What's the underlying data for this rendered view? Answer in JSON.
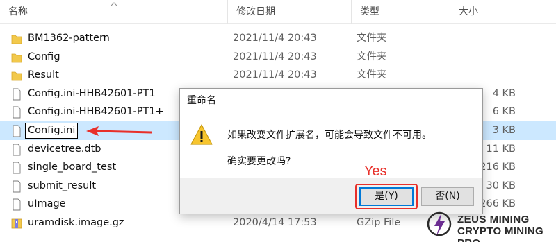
{
  "columns": {
    "name": "名称",
    "date": "修改日期",
    "type": "类型",
    "size": "大小"
  },
  "files": [
    {
      "name": "BM1362-pattern",
      "date": "2021/11/4 20:43",
      "type": "文件夹",
      "size": "",
      "icon": "folder-icon"
    },
    {
      "name": "Config",
      "date": "2021/11/4 20:43",
      "type": "文件夹",
      "size": "",
      "icon": "folder-icon"
    },
    {
      "name": "Result",
      "date": "2021/11/4 20:43",
      "type": "文件夹",
      "size": "",
      "icon": "folder-icon"
    },
    {
      "name": "Config.ini-HHB42601-PT1",
      "date": "",
      "type": "",
      "size": "4 KB",
      "icon": "file-icon"
    },
    {
      "name": "Config.ini-HHB42601-PT1+",
      "date": "",
      "type": "",
      "size": "6 KB",
      "icon": "file-icon"
    },
    {
      "name": "Config.ini",
      "date": "",
      "type": "",
      "size": "3 KB",
      "icon": "file-icon"
    },
    {
      "name": "devicetree.dtb",
      "date": "",
      "type": "",
      "size": "11 KB",
      "icon": "file-icon"
    },
    {
      "name": "single_board_test",
      "date": "",
      "type": "",
      "size": "216 KB",
      "icon": "file-icon"
    },
    {
      "name": "submit_result",
      "date": "",
      "type": "",
      "size": "30 KB",
      "icon": "file-icon"
    },
    {
      "name": "uImage",
      "date": "",
      "type": "",
      "size": "266 KB",
      "icon": "file-icon"
    },
    {
      "name": "uramdisk.image.gz",
      "date": "2020/4/14 17:53",
      "type": "GZip File",
      "size": "",
      "icon": "archive-icon"
    }
  ],
  "dialog": {
    "title": "重命名",
    "message": "如果改变文件扩展名，可能会导致文件不可用。",
    "question": "确实要更改吗?",
    "yes_label": "是(",
    "yes_key": "Y",
    "no_label": "否(",
    "no_key": "N",
    "close_paren": ")",
    "icon": "warning-icon"
  },
  "annotation": {
    "yes_text": "Yes",
    "color": "#e8302a"
  },
  "watermark": {
    "line1": "ZEUS MINING",
    "line2": "CRYPTO MINING PRO"
  },
  "colors": {
    "selection": "#cce8ff",
    "accent": "#0078d7",
    "folder": "#f2c94c"
  }
}
